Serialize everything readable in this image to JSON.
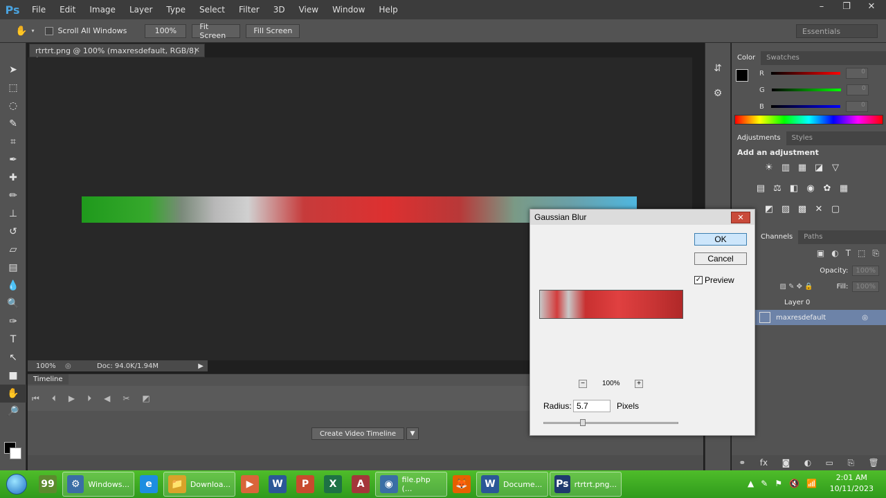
{
  "app": {
    "logo": "Ps",
    "menu": [
      "File",
      "Edit",
      "Image",
      "Layer",
      "Type",
      "Select",
      "Filter",
      "3D",
      "View",
      "Window",
      "Help"
    ],
    "window_controls": [
      "–",
      "❐",
      "✕"
    ]
  },
  "options_bar": {
    "scroll_all_windows": "Scroll All Windows",
    "zoom_100": "100%",
    "fit_screen": "Fit Screen",
    "fill_screen": "Fill Screen",
    "workspace": "Essentials"
  },
  "document": {
    "tab_title": "rtrtrt.png @ 100% (maxresdefault, RGB/8) *",
    "zoom": "100%",
    "doc_size": "Doc: 94.0K/1.94M"
  },
  "timeline": {
    "tab": "Timeline",
    "create_button": "Create Video Timeline"
  },
  "panels": {
    "color_tabs": [
      "Color",
      "Swatches"
    ],
    "rgb_labels": [
      "R",
      "G",
      "B"
    ],
    "rgb_values": [
      "0",
      "0",
      "0"
    ],
    "adjust_tabs": [
      "Adjustments",
      "Styles"
    ],
    "add_adjustment": "Add an adjustment",
    "layer_tabs": [
      "Channels",
      "Paths"
    ],
    "opacity_label": "Opacity:",
    "opacity_value": "100%",
    "fill_label": "Fill:",
    "fill_value": "100%",
    "layers": [
      "Layer 0",
      "maxresdefault"
    ]
  },
  "dialog": {
    "title": "Gaussian Blur",
    "close": "✕",
    "ok": "OK",
    "cancel": "Cancel",
    "preview_label": "Preview",
    "preview_checked": "✓",
    "zoom": "100%",
    "zoom_minus": "−",
    "zoom_plus": "+",
    "radius_label": "Radius:",
    "radius_value": "5.7",
    "unit": "Pixels",
    "radius_slider_fraction": 0.29
  },
  "taskbar": {
    "items": [
      {
        "icon": "99",
        "label": ""
      },
      {
        "icon": "⚙",
        "label": "Windows..."
      },
      {
        "icon": "e",
        "label": ""
      },
      {
        "icon": "📁",
        "label": "Downloa..."
      },
      {
        "icon": "▶",
        "label": ""
      },
      {
        "icon": "W",
        "label": ""
      },
      {
        "icon": "P",
        "label": ""
      },
      {
        "icon": "X",
        "label": ""
      },
      {
        "icon": "A",
        "label": ""
      },
      {
        "icon": "◉",
        "label": "file.php (..."
      },
      {
        "icon": "🦊",
        "label": ""
      },
      {
        "icon": "W",
        "label": "Docume..."
      },
      {
        "icon": "Ps",
        "label": "rtrtrt.png..."
      }
    ],
    "time": "2:01 AM",
    "date": "10/11/2023"
  }
}
